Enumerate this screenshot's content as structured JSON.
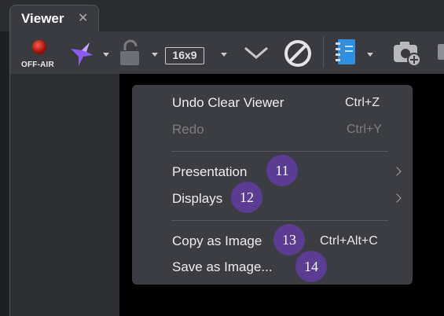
{
  "window": {
    "tab_label": "Viewer",
    "tab_close_icon": "close-icon"
  },
  "toolbar": {
    "offair_label": "OFF-AIR",
    "ratio_label": "16x9",
    "icons": [
      "record-light-icon",
      "bird-logo-icon",
      "lock-icon",
      "aspect-ratio-icon",
      "chevron-down-icon",
      "no-entry-icon",
      "notebook-icon",
      "camera-add-icon"
    ]
  },
  "context_menu": {
    "items": [
      {
        "label": "Undo Clear Viewer",
        "shortcut": "Ctrl+Z",
        "enabled": true
      },
      {
        "label": "Redo",
        "shortcut": "Ctrl+Y",
        "enabled": false
      },
      {
        "label": "Presentation",
        "shortcut": "",
        "submenu": true,
        "enabled": true
      },
      {
        "label": "Displays",
        "shortcut": "",
        "submenu": true,
        "enabled": true
      },
      {
        "label": "Copy as Image",
        "shortcut": "Ctrl+Alt+C",
        "enabled": true
      },
      {
        "label": "Save as Image...",
        "shortcut": "",
        "enabled": true
      }
    ]
  },
  "callouts": [
    "11",
    "12",
    "13",
    "14"
  ],
  "colors": {
    "badge": "#5a3c92",
    "menu_bg": "#3c3d42",
    "accent_blue": "#2f8fe0",
    "bird_purple": "#8a5cf0"
  }
}
